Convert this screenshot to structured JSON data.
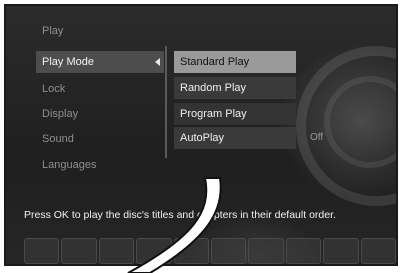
{
  "menu": {
    "items": [
      {
        "label": "Play",
        "selected": false
      },
      {
        "label": "Play Mode",
        "selected": true
      },
      {
        "label": "Lock",
        "selected": false
      },
      {
        "label": "Display",
        "selected": false
      },
      {
        "label": "Sound",
        "selected": false
      },
      {
        "label": "Languages",
        "selected": false
      }
    ]
  },
  "submenu": {
    "items": [
      {
        "label": "Standard Play",
        "selected": true
      },
      {
        "label": "Random Play",
        "selected": false
      },
      {
        "label": "Program Play",
        "selected": false
      },
      {
        "label": "AutoPlay",
        "selected": false
      }
    ],
    "autoplay_value": "Off"
  },
  "help": {
    "text": "Press OK to play the disc's titles and chapters in their default order."
  },
  "icons": {
    "submenu_arrow": "left-arrow-icon"
  }
}
